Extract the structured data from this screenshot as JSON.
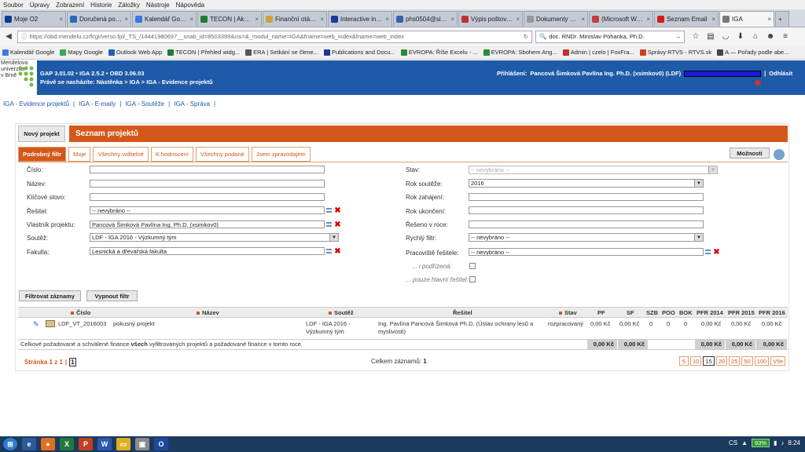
{
  "menubar": [
    "Soubor",
    "Úpravy",
    "Zobrazení",
    "Historie",
    "Záložky",
    "Nástroje",
    "Nápověda"
  ],
  "tabs": [
    {
      "label": "Moje O2",
      "color": "#0a3d8f"
    },
    {
      "label": "Doručená pošta -",
      "color": "#2a6ab5"
    },
    {
      "label": "Kalendář Goog...",
      "color": "#3b78e7"
    },
    {
      "label": "TECON | Akce ...",
      "color": "#1f7a3a"
    },
    {
      "label": "Finanční otázk...",
      "color": "#caa23a"
    },
    {
      "label": "Interactive inn...",
      "color": "#1a3a9a"
    },
    {
      "label": "phs0504@sim...",
      "color": "#3a60b0"
    },
    {
      "label": "Výpis poštovní...",
      "color": "#c03030"
    },
    {
      "label": "Dokumenty pro ro...",
      "color": "#999999"
    },
    {
      "label": "(Microsoft Wo...",
      "color": "#c04040"
    },
    {
      "label": "Seznam Email",
      "color": "#d02020"
    },
    {
      "label": "IGA",
      "color": "#7a7a7a"
    }
  ],
  "nav": {
    "url": "https://obd.mendelu.cz/fcgi/verso.fpl/_TS_/14441980697__snab_id=8503399&cis=&_modul_name=IGA&fname=web_index&fname=web_index",
    "search": "doc. RNDr. Miroslav Pohanka, Ph.D."
  },
  "bookmarks": [
    {
      "label": "Kalendář Google",
      "color": "#3b78e7"
    },
    {
      "label": "Mapy Google",
      "color": "#3aa657"
    },
    {
      "label": "Outlook Web App",
      "color": "#1f5fb5"
    },
    {
      "label": "TECON | Přehled widg...",
      "color": "#1f7a3a"
    },
    {
      "label": "ERA | Setkání se člene...",
      "color": "#555555"
    },
    {
      "label": "Publications and Docu...",
      "color": "#1a3a9a"
    },
    {
      "label": "EVROPA: Říše Excelu - ...",
      "color": "#2a8a3a"
    },
    {
      "label": "EVROPA: Sbohem Ang...",
      "color": "#2a8a3a"
    },
    {
      "label": "Admin | czelo | FoxFra...",
      "color": "#c03030"
    },
    {
      "label": "Správy RTVS - RTVS.sk",
      "color": "#d04020"
    },
    {
      "label": "A — Pořady podle abe...",
      "color": "#444444"
    }
  ],
  "header": {
    "logo_text": [
      "Mendelova",
      "univerzita",
      "v Brně"
    ],
    "versions": "GAP 3.01.02 • IGA 2.5.2 • OBD 3.06.03",
    "location": "Právě se nacházíte: Nástěnka > IGA > IGA - Evidence projektů",
    "login_label": "Přihlášení:",
    "login_user": "Pancová Šimková Pavlína Ing. Ph.D. (xsimkov0) (LDF)",
    "logout": "Odhlásit"
  },
  "topnav": [
    "IGA - Evidence projektů",
    "IGA - E-maily",
    "IGA - Soutěže",
    "IGA - Správa"
  ],
  "new_project": "Nový projekt",
  "title": "Seznam projektů",
  "filter_tabs": [
    "Podrobný filtr",
    "Moje",
    "Všechny viditelné",
    "K hodnocení",
    "Všechny podané",
    "Jsem zpravodajem"
  ],
  "options_btn": "Možnosti",
  "filter_left": [
    {
      "label": "Číslo:",
      "value": ""
    },
    {
      "label": "Název:",
      "value": ""
    },
    {
      "label": "Klíčové slovo:",
      "value": ""
    },
    {
      "label": "Řešitel:",
      "value": "-- nevybráno --"
    },
    {
      "label": "Vlastník projektu:",
      "value": "Pancová Šimková Pavlína Ing. Ph.D. (xsimkov0)"
    },
    {
      "label": "Soutěž:",
      "value": "LDF - IGA 2016 - Výzkumný tým"
    },
    {
      "label": "Fakulta:",
      "value": "Lesnická a dřevařská fakulta"
    }
  ],
  "filter_right": [
    {
      "label": "Stav:",
      "value": "-- nevybráno --"
    },
    {
      "label": "Rok soutěže:",
      "value": "2016"
    },
    {
      "label": "Rok zahájení:",
      "value": ""
    },
    {
      "label": "Rok ukončení:",
      "value": ""
    },
    {
      "label": "Řešeno v roce:",
      "value": ""
    },
    {
      "label": "Rychlý filtr:",
      "value": "-- nevybráno --"
    },
    {
      "label": "Pracoviště řešitele:",
      "value": "-- nevybráno --"
    },
    {
      "label": "... i podřízená:",
      "value": ""
    },
    {
      "label": "... pouze hlavní řešitel:",
      "value": ""
    }
  ],
  "buttons": {
    "filter": "Filtrovat záznamy",
    "clear": "Vypnout filtr"
  },
  "table": {
    "headers": [
      "Číslo",
      "Název",
      "Soutěž",
      "Řešitel",
      "Stav",
      "PF",
      "SF",
      "SZB",
      "POO",
      "BOK",
      "PFR 2014",
      "PFR 2015",
      "PFR 2016"
    ],
    "row": {
      "cislo": "LDF_VT_2016003",
      "nazev": "pokusný projekt",
      "soutez": "LDF - IGA 2016 - Výzkumný tým",
      "resitel": "Ing. Pavlína Pancová Šimková Ph.D. (Ústav ochrany lesů a myslivosti)",
      "stav": "rozpracovaný",
      "pf": "0,00 Kč",
      "sf": "0,00 Kč",
      "szb": "0",
      "poo": "0",
      "bok": "0",
      "pfr2014": "0,00 Kč",
      "pfr2015": "0,00 Kč",
      "pfr2016": "0,00 Kč"
    },
    "summary_pre": "Celkové požadované a schválené finance ",
    "summary_bold": "všech",
    "summary_post": " vyfiltrovaných projektů a požadované finance v tomto roce.",
    "sums": {
      "pf": "0,00 Kč",
      "sf": "0,00 Kč",
      "pfr2014": "0,00 Kč",
      "pfr2015": "0,00 Kč",
      "pfr2016": "0,00 Kč"
    }
  },
  "pager": {
    "label": "Stránka 1 z 1",
    "current": "1",
    "total_label": "Celkem záznamů:",
    "total": "1",
    "sizes": [
      "5",
      "10",
      "15",
      "20",
      "25",
      "50",
      "100",
      "Vše"
    ],
    "current_size": "15"
  },
  "taskbar": {
    "lang": "CS",
    "battery": "93%",
    "time": "8:24"
  }
}
